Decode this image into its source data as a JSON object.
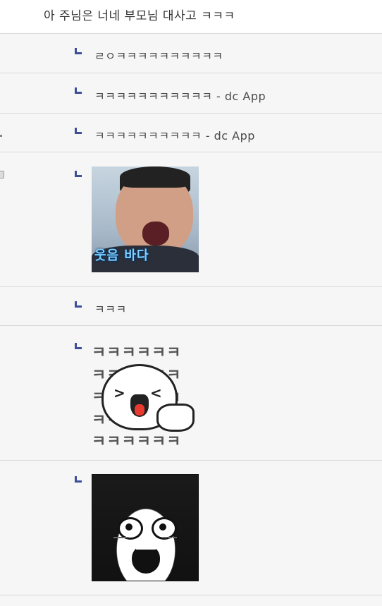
{
  "top_comment": "아 주님은 너네 부모님 대사고 ㅋㅋㅋ",
  "replies": [
    {
      "text": "ㄹㅇㅋㅋㅋㅋㅋㅋㅋㅋㅋㅋ"
    },
    {
      "text": "ㅋㅋㅋㅋㅋㅋㅋㅋㅋㅋㅋ - dc App"
    },
    {
      "text": "ㅋㅋㅋㅋㅋㅋㅋㅋㅋㅋ - dc App"
    },
    {
      "type": "image",
      "image_caption": "웃음 바다",
      "icon": "laughing-man-image"
    },
    {
      "text": "ㅋㅋㅋ"
    },
    {
      "type": "image",
      "icon": "laughing-bun-sticker",
      "sticker_text": "ㅋㅋㅋㅋㅋㅋ"
    },
    {
      "type": "image",
      "icon": "crying-anime-girl-image"
    }
  ],
  "colors": {
    "reply_marker": "#3b4f9a",
    "background": "#f6f6f6",
    "divider": "#d8d8d8"
  }
}
